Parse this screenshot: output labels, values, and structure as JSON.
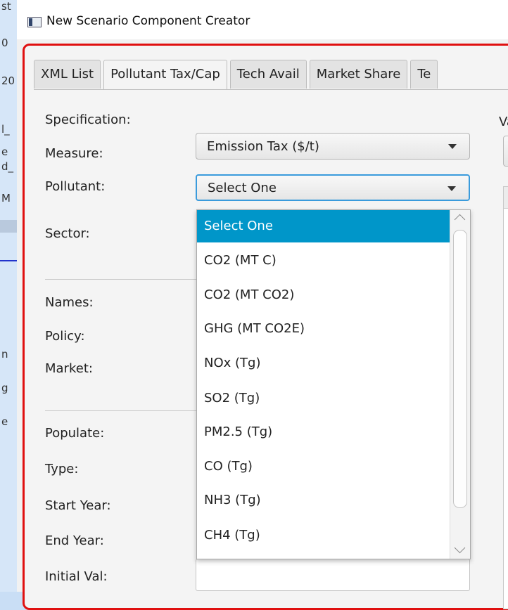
{
  "window": {
    "title": "New Scenario Component Creator"
  },
  "background_fragments": [
    "st",
    "0",
    "20",
    "l_",
    "e",
    "d_",
    "M",
    "n",
    "g",
    "e"
  ],
  "tabs": [
    {
      "label": "XML List",
      "active": false
    },
    {
      "label": "Pollutant Tax/Cap",
      "active": true
    },
    {
      "label": "Tech Avail",
      "active": false
    },
    {
      "label": "Market Share",
      "active": false
    },
    {
      "label": "Te",
      "active": false
    }
  ],
  "form": {
    "specification_label": "Specification:",
    "measure_label": "Measure:",
    "measure_value": "Emission Tax ($/t)",
    "pollutant_label": "Pollutant:",
    "pollutant_value": "Select One",
    "sector_label": "Sector:",
    "names_label": "Names:",
    "policy_label": "Policy:",
    "market_label": "Market:",
    "populate_label": "Populate:",
    "type_label": "Type:",
    "start_year_label": "Start Year:",
    "end_year_label": "End Year:",
    "initial_val_label": "Initial Val:"
  },
  "right_panel": {
    "label": "Va"
  },
  "dropdown": {
    "selected": "Select One",
    "options": [
      "Select One",
      "CO2 (MT C)",
      "CO2 (MT CO2)",
      "GHG (MT CO2E)",
      "NOx (Tg)",
      "SO2 (Tg)",
      "PM2.5 (Tg)",
      "CO (Tg)",
      "NH3 (Tg)",
      "CH4 (Tg)"
    ]
  },
  "colors": {
    "accent": "#0096c9",
    "focus_border": "#3a9bdc",
    "frame_border": "#e01010",
    "background": "#c9def5"
  }
}
